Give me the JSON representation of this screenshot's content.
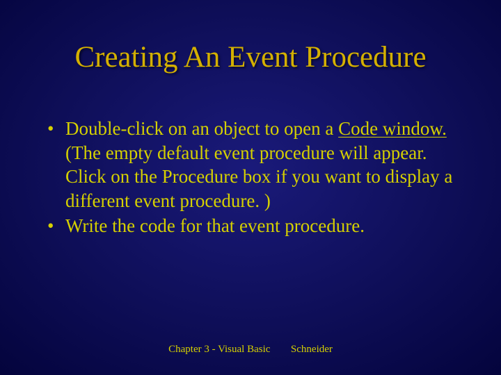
{
  "title": "Creating An Event Procedure",
  "bullets": [
    {
      "pre": "Double-click on an object to open a ",
      "underlined": "Code window.",
      "post": " (The empty default event procedure will appear. Click on the Procedure box if you want to display a different event procedure. )"
    },
    {
      "pre": "Write the code for that event procedure.",
      "underlined": "",
      "post": ""
    }
  ],
  "footer": {
    "left": "Chapter 3 - Visual Basic",
    "right": "Schneider"
  }
}
